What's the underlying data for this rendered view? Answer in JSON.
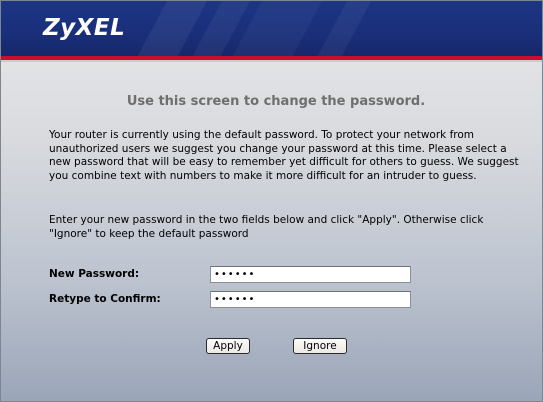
{
  "brand": {
    "logo_text": "ZyXEL"
  },
  "page": {
    "title": "Use this screen to change the password.",
    "intro_paragraph": "Your router is currently using the default password. To protect your network from unauthorized users we suggest you change your password at this time. Please select a new password that will be easy to remember yet difficult for others to guess.  We suggest you combine text with numbers to make it more difficult for an intruder to guess.",
    "instruction_paragraph": "Enter your new password in the two fields below and click \"Apply\". Otherwise click \"Ignore\" to keep the default password"
  },
  "form": {
    "new_password": {
      "label": "New Password:",
      "value": "••••••"
    },
    "retype_password": {
      "label": "Retype to Confirm:",
      "value": "••••••"
    },
    "apply_label": "Apply",
    "ignore_label": "Ignore"
  },
  "colors": {
    "header_blue": "#1a2f7a",
    "accent_red": "#c8102e",
    "title_grey": "#6e6e6e"
  }
}
